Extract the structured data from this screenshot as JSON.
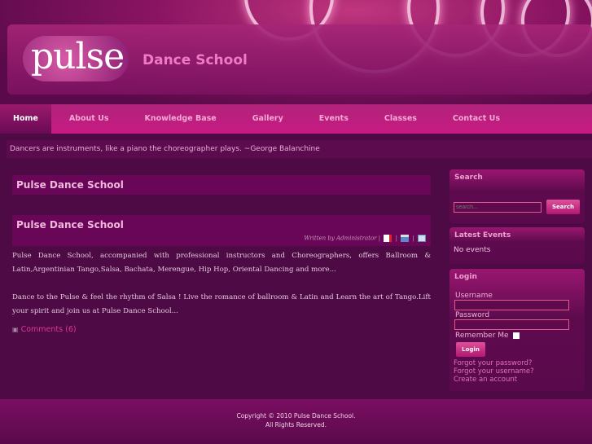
{
  "header": {
    "logo": "pulse",
    "site_name": "Dance School"
  },
  "nav": [
    {
      "label": "Home"
    },
    {
      "label": "About Us"
    },
    {
      "label": "Knowledge Base"
    },
    {
      "label": "Gallery"
    },
    {
      "label": "Events"
    },
    {
      "label": "Classes"
    },
    {
      "label": "Contact Us"
    }
  ],
  "quote": "Dancers are instruments, like a piano the choreographer plays. ~George Balanchine",
  "main": {
    "page_title": "Pulse Dance School",
    "article_title": "Pulse Dance School",
    "meta": "Written by Administrator",
    "sep": "|",
    "paragraphs": [
      "Pulse Dance School, accompanied with professional instructors and Choreographers, offers Ballroom & Latin,Argentinian Tango,Salsa, Bachata, Merengue, Hip Hop, Oriental Dancing and more...",
      "Dance to the Pulse & feel the rhythm of Salsa ! Live the romance of ballroom & Latin and Learn the art of Tango.Lift your spirit and join us at Pulse Dance School..."
    ],
    "comments": "Comments (6)"
  },
  "sidebar": {
    "search": {
      "title": "Search",
      "placeholder": "search...",
      "button": "Search"
    },
    "events": {
      "title": "Latest Events",
      "empty": "No events"
    },
    "login": {
      "title": "Login",
      "username": "Username",
      "password": "Password",
      "remember": "Remember Me",
      "button": "Login",
      "forgot_password": "Forgot your password?",
      "forgot_username": "Forgot your username?",
      "create": "Create an account"
    }
  },
  "footer": {
    "copyright": "Copyright © 2010 Pulse Dance School.",
    "rights": "All Rights Reserved."
  }
}
